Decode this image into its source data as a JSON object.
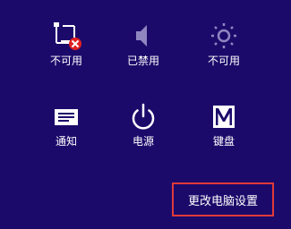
{
  "tiles": [
    {
      "label": "不可用",
      "icon": "network-unavailable-icon"
    },
    {
      "label": "已禁用",
      "icon": "speaker-icon"
    },
    {
      "label": "不可用",
      "icon": "brightness-icon"
    },
    {
      "label": "通知",
      "icon": "notification-icon"
    },
    {
      "label": "电源",
      "icon": "power-icon"
    },
    {
      "label": "键盘",
      "icon": "keyboard-icon"
    }
  ],
  "change_settings_label": "更改电脑设置",
  "colors": {
    "background": "#1c0a6b",
    "foreground": "#ffffff",
    "muted_icon": "#8f86c0",
    "highlight_border": "#e03a3a",
    "error_badge": "#e02020"
  }
}
